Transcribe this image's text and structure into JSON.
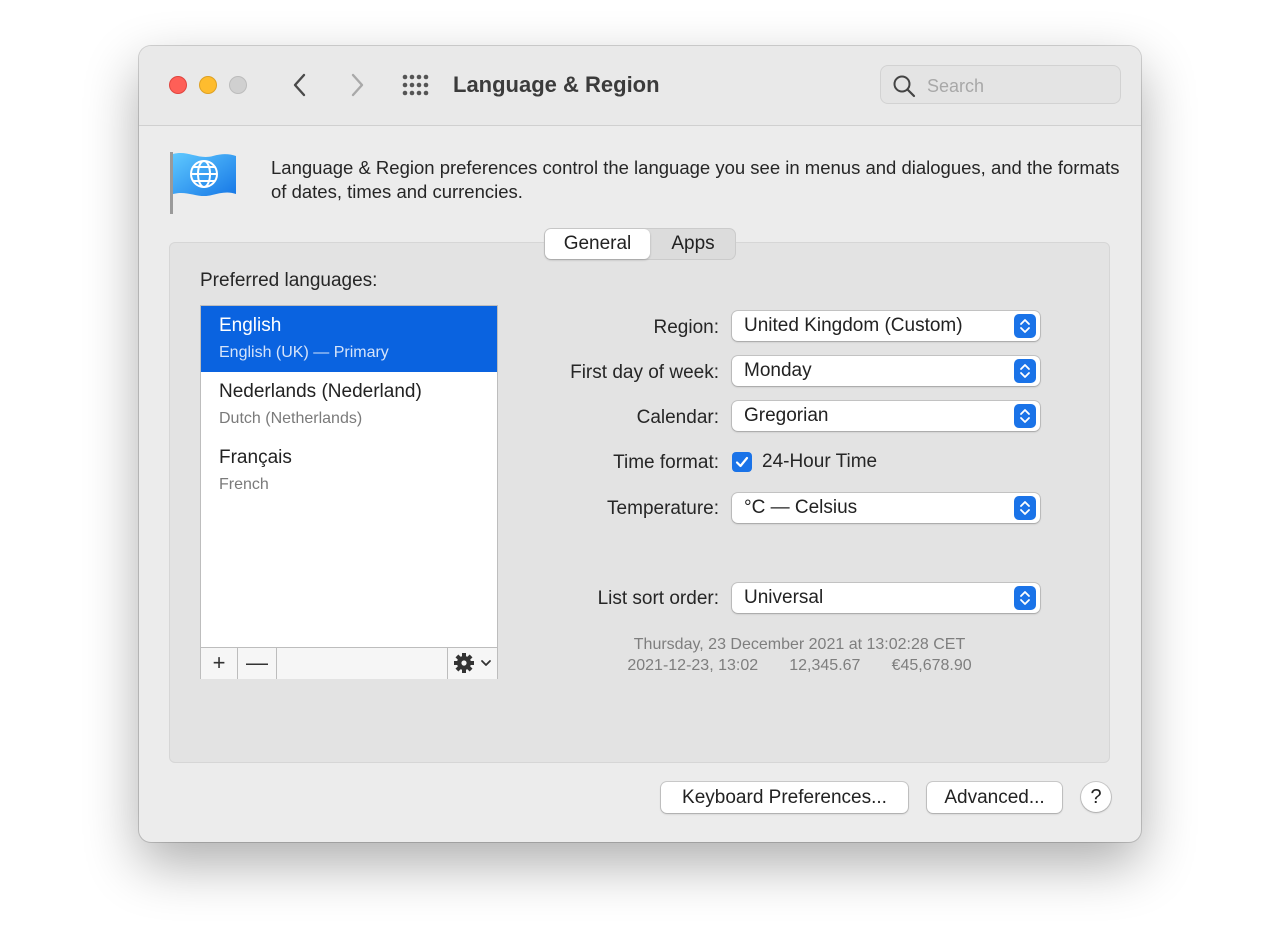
{
  "window": {
    "title": "Language & Region",
    "search": {
      "placeholder": "Search",
      "value": ""
    }
  },
  "intro": {
    "text": "Language & Region preferences control the language you see in menus and dialogues, and the formats of dates, times and currencies."
  },
  "tabs": [
    {
      "label": "General",
      "selected": true
    },
    {
      "label": "Apps",
      "selected": false
    }
  ],
  "languages": {
    "heading": "Preferred languages:",
    "items": [
      {
        "name": "English",
        "detail": "English (UK) — Primary",
        "selected": true
      },
      {
        "name": "Nederlands (Nederland)",
        "detail": "Dutch (Netherlands)",
        "selected": false
      },
      {
        "name": "Français",
        "detail": "French",
        "selected": false
      }
    ],
    "toolbar": {
      "add": "+",
      "remove": "—"
    }
  },
  "settings": {
    "region": {
      "label": "Region:",
      "value": "United Kingdom (Custom)"
    },
    "first_day": {
      "label": "First day of week:",
      "value": "Monday"
    },
    "calendar": {
      "label": "Calendar:",
      "value": "Gregorian"
    },
    "time_format": {
      "label": "Time format:",
      "checkbox_label": "24-Hour Time",
      "checked": true
    },
    "temperature": {
      "label": "Temperature:",
      "value": "°C — Celsius"
    },
    "sort_order": {
      "label": "List sort order:",
      "value": "Universal"
    }
  },
  "sample": {
    "date_long": "Thursday, 23 December 2021 at 13:02:28 CET",
    "date_short": "2021-12-23, 13:02",
    "number": "12,345.67",
    "currency": "€45,678.90"
  },
  "buttons": {
    "keyboard": "Keyboard Preferences...",
    "advanced": "Advanced...",
    "help": "?"
  },
  "colors": {
    "accent": "#1a73e8",
    "selection": "#0a63e0",
    "close": "#fe5f57",
    "minimize": "#febc2e",
    "zoom_disabled": "#d0d0d0"
  },
  "icons": {
    "back": "chevron-left-icon",
    "forward": "chevron-right-icon",
    "all_prefs": "grid-icon",
    "search": "search-icon",
    "flag": "globe-flag-icon",
    "gear": "gear-icon",
    "popup": "up-down-chevron-icon",
    "checkbox": "checkmark-icon"
  }
}
